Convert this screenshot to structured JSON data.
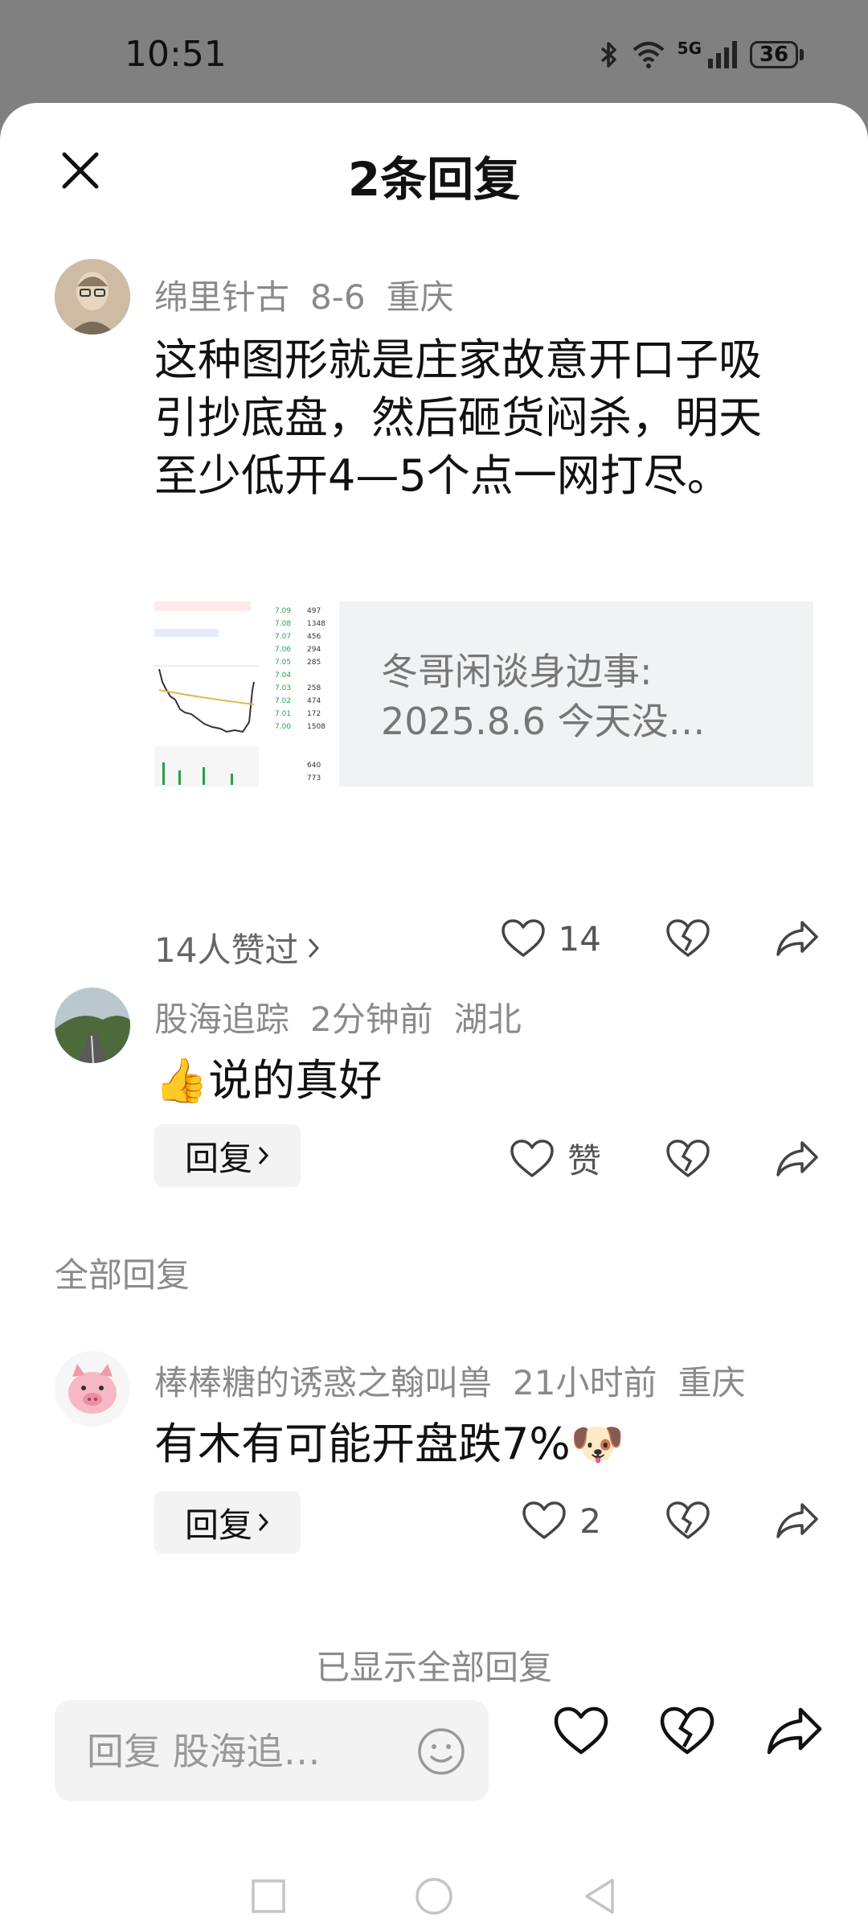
{
  "status": {
    "time": "10:51",
    "network": "5G",
    "battery": "36"
  },
  "header": {
    "title": "2条回复"
  },
  "main_comment": {
    "author": "绵里针古",
    "date": "8-6",
    "location": "重庆",
    "text": "这种图形就是庄家故意开口子吸引抄底盘，然后砸货闷杀，明天至少低开4—5个点一网打尽。",
    "quote": "冬哥闲谈身边事: 2025.8.6 今天没…",
    "likers": "14人赞过",
    "like_count": "14"
  },
  "reply_1": {
    "author": "股海追踪",
    "date": "2分钟前",
    "location": "湖北",
    "emoji": "👍",
    "text": "说的真好",
    "reply_label": "回复",
    "like_label": "赞"
  },
  "section_label": "全部回复",
  "reply_2": {
    "author": "棒棒糖的诱惑之翰叫兽",
    "date": "21小时前",
    "location": "重庆",
    "text": "有木有可能开盘跌7%",
    "emoji": "🐶",
    "reply_label": "回复",
    "like_count": "2"
  },
  "end_note": "已显示全部回复",
  "input": {
    "placeholder": "回复 股海追…"
  }
}
